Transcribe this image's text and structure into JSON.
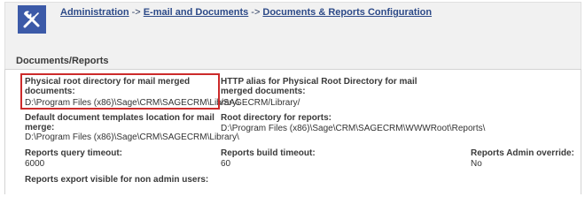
{
  "app": {
    "icon": "tools-icon",
    "accent": "#3c5aa8"
  },
  "breadcrumb": {
    "items": [
      "Administration",
      "E-mail and Documents",
      "Documents & Reports Configuration"
    ],
    "separator": "->"
  },
  "section": {
    "title": "Documents/Reports"
  },
  "fields": {
    "physical_root": {
      "label": "Physical root directory for mail merged documents:",
      "value": "D:\\Program Files (x86)\\Sage\\CRM\\SAGECRM\\Library\\"
    },
    "http_alias": {
      "label": "HTTP alias for Physical Root Directory for mail merged documents:",
      "value": "/SAGECRM/Library/"
    },
    "default_templates": {
      "label": "Default document templates location for mail merge:",
      "value": "D:\\Program Files (x86)\\Sage\\CRM\\SAGECRM\\Library\\"
    },
    "reports_root": {
      "label": "Root directory for reports:",
      "value": "D:\\Program Files (x86)\\Sage\\CRM\\SAGECRM\\WWWRoot\\Reports\\"
    },
    "query_timeout": {
      "label": "Reports query timeout:",
      "value": "6000"
    },
    "build_timeout": {
      "label": "Reports build timeout:",
      "value": "60"
    },
    "admin_override": {
      "label": "Reports Admin override:",
      "value": "No"
    },
    "export_visible": {
      "label": "Reports export visible for non admin users:"
    }
  },
  "highlight_color": "#cc2a2a"
}
